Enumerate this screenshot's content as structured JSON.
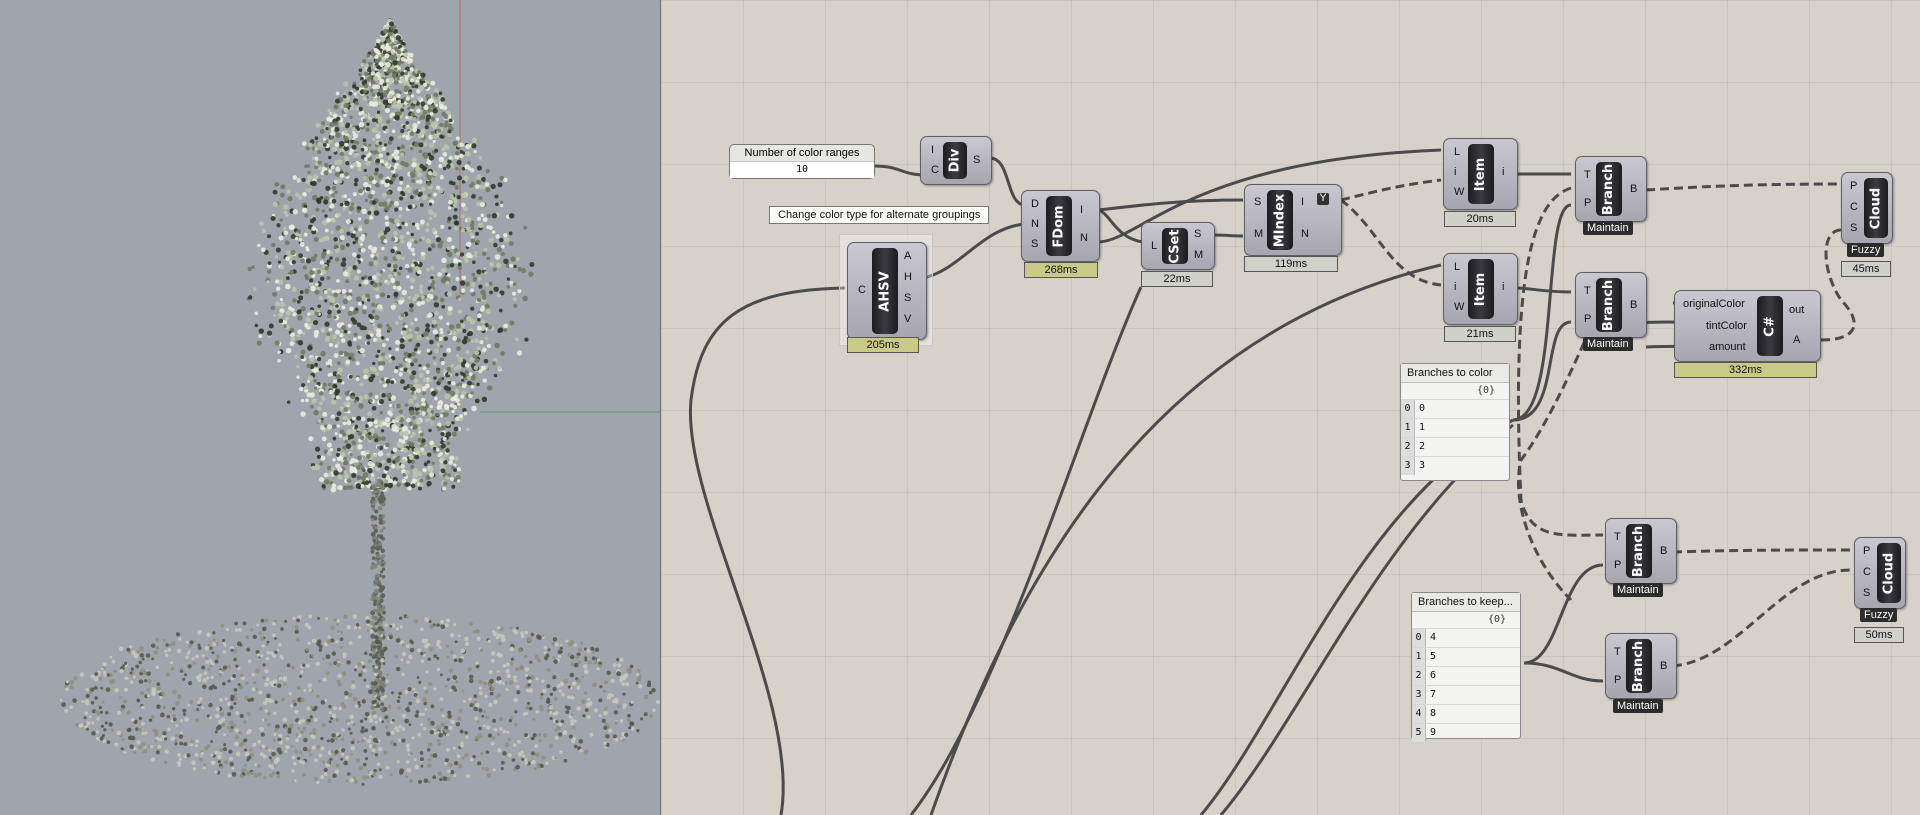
{
  "canvas": {
    "slider": {
      "label": "Number of color ranges",
      "value": "10"
    },
    "tooltip": "Change color type for alternate groupings",
    "components": {
      "div": {
        "name": "Div",
        "inputs": [
          "I",
          "C"
        ],
        "outputs": [
          "S"
        ]
      },
      "ahsv": {
        "name": "AHSV",
        "inputs": [
          "C"
        ],
        "outputs": [
          "A",
          "H",
          "S",
          "V"
        ],
        "time": "205ms"
      },
      "fdom": {
        "name": "FDom",
        "inputs": [
          "D",
          "N",
          "S"
        ],
        "outputs": [
          "I",
          "N"
        ],
        "time": "268ms"
      },
      "cset": {
        "name": "CSet",
        "inputs": [
          "L"
        ],
        "outputs": [
          "S",
          "M"
        ],
        "time": "22ms"
      },
      "mindex": {
        "name": "MIndex",
        "inputs": [
          "S",
          "M"
        ],
        "outputs": [
          "I",
          "N"
        ],
        "flag": "Y",
        "time": "119ms"
      },
      "item1": {
        "name": "Item",
        "inputs": [
          "L",
          "i",
          "W"
        ],
        "outputs": [
          "i"
        ],
        "time": "20ms"
      },
      "item2": {
        "name": "Item",
        "inputs": [
          "L",
          "i",
          "W"
        ],
        "outputs": [
          "i"
        ],
        "time": "21ms"
      },
      "branch1": {
        "name": "Branch",
        "inputs": [
          "T",
          "P"
        ],
        "outputs": [
          "B"
        ],
        "tag": "Maintain"
      },
      "branch2": {
        "name": "Branch",
        "inputs": [
          "T",
          "P"
        ],
        "outputs": [
          "B"
        ],
        "tag": "Maintain"
      },
      "branch3": {
        "name": "Branch",
        "inputs": [
          "T",
          "P"
        ],
        "outputs": [
          "B"
        ],
        "tag": "Maintain"
      },
      "branch4": {
        "name": "Branch",
        "inputs": [
          "T",
          "P"
        ],
        "outputs": [
          "B"
        ],
        "tag": "Maintain"
      },
      "cloud1": {
        "name": "Cloud",
        "inputs": [
          "P",
          "C",
          "S"
        ],
        "tag": "Fuzzy",
        "time": "45ms"
      },
      "cloud2": {
        "name": "Cloud",
        "inputs": [
          "P",
          "C",
          "S"
        ],
        "tag": "Fuzzy",
        "time": "50ms"
      },
      "csharp": {
        "name": "C#",
        "inputs": [
          "originalColor",
          "tintColor",
          "amount"
        ],
        "outputs": [
          "out",
          "A"
        ],
        "time": "332ms"
      }
    },
    "panels": {
      "color": {
        "title": "Branches to color",
        "path": "{0}",
        "rows": [
          {
            "i": "0",
            "v": "0"
          },
          {
            "i": "1",
            "v": "1"
          },
          {
            "i": "2",
            "v": "2"
          },
          {
            "i": "3",
            "v": "3"
          }
        ]
      },
      "keep": {
        "title": "Branches to keep...",
        "path": "{0}",
        "rows": [
          {
            "i": "0",
            "v": "4"
          },
          {
            "i": "1",
            "v": "5"
          },
          {
            "i": "2",
            "v": "6"
          },
          {
            "i": "3",
            "v": "7"
          },
          {
            "i": "4",
            "v": "8"
          },
          {
            "i": "5",
            "v": "9"
          }
        ]
      }
    }
  }
}
